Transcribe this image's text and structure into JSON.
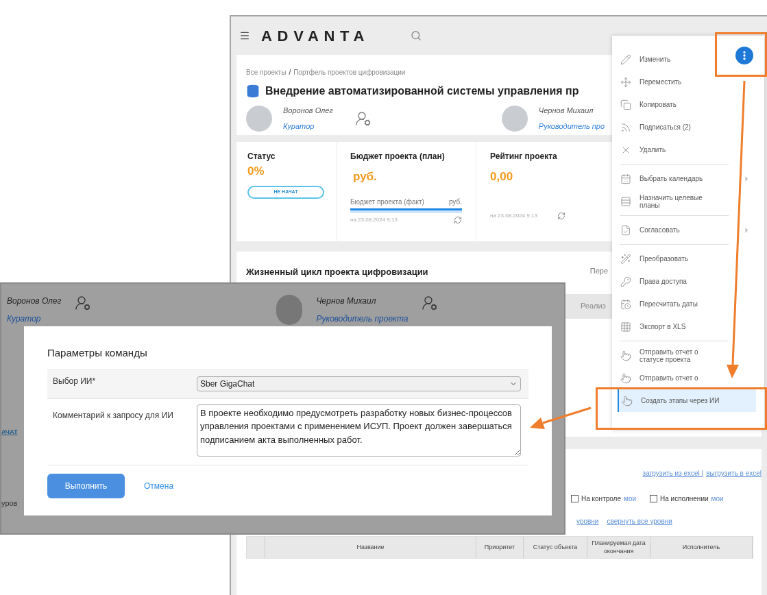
{
  "header": {
    "logo": "ADVANTA"
  },
  "breadcrumbs": {
    "items": [
      "Все проекты",
      "Портфель проектов цифровизации"
    ],
    "separator": "/"
  },
  "project": {
    "title": "Внедрение автоматизированной системы управления пр"
  },
  "people": [
    {
      "name": "Воронов Олег",
      "role": "Куратор"
    },
    {
      "name": "Чернов Михаил",
      "role": "Руководитель про"
    }
  ],
  "metrics": [
    {
      "kind": "status",
      "label": "Статус",
      "value": "0%",
      "badge": "НЕ НАЧАТ"
    },
    {
      "kind": "budget",
      "label": "Бюджет проекта (план)",
      "value": "руб.",
      "sub_label": "Бюджет проекта (факт)",
      "sub_value": "руб.",
      "level": 1,
      "date": "на 23.08.2024 9:13"
    },
    {
      "kind": "rating",
      "label": "Рейтинг проекта",
      "value": "0,00",
      "date": "на 23.08.2024 9:13"
    }
  ],
  "lifecycle": {
    "title": "Жизненный цикл проекта цифровизации",
    "column_2": "Пере",
    "stage": "Реализ"
  },
  "stages": {
    "links": [
      "загрузить из excel |",
      "выгрузить в excel"
    ],
    "filters": [
      {
        "label": "На контроле",
        "link": "мои",
        "checked": false
      },
      {
        "label": "На исполнении",
        "link": "мои",
        "checked": false
      }
    ],
    "level_links": [
      "уровни",
      "свернуть все уровни"
    ],
    "columns": [
      "Название",
      "Приоритет",
      "Статус объекта",
      "Планируемая дата окончания",
      "Исполнитель"
    ]
  },
  "menu": {
    "groups": [
      [
        {
          "label": "Изменить",
          "submenu": false,
          "selected": false
        },
        {
          "label": "Переместить",
          "submenu": false,
          "selected": false
        },
        {
          "label": "Копировать",
          "submenu": false,
          "selected": false
        },
        {
          "label": "Подписаться (2)",
          "submenu": false,
          "selected": false
        },
        {
          "label": "Удалить",
          "submenu": false,
          "selected": false
        }
      ],
      [
        {
          "label": "Выбрать календарь",
          "submenu": true,
          "selected": false
        },
        {
          "label": "Назначить целевые планы",
          "submenu": false,
          "selected": false
        }
      ],
      [
        {
          "label": "Согласовать",
          "submenu": true,
          "selected": false
        }
      ],
      [
        {
          "label": "Преобразовать",
          "submenu": false,
          "selected": false
        },
        {
          "label": "Права доступа",
          "submenu": false,
          "selected": false
        },
        {
          "label": "Пересчитать даты",
          "submenu": false,
          "selected": false
        },
        {
          "label": "Экспорт в XLS",
          "submenu": false,
          "selected": false
        }
      ],
      [
        {
          "label": "Отправить отчет о статусе проекта",
          "submenu": false,
          "selected": false
        },
        {
          "label": "Отправить отчет о",
          "submenu": false,
          "selected": false
        },
        {
          "label": "Создать этапы через ИИ",
          "submenu": false,
          "selected": true
        }
      ]
    ]
  },
  "dialog": {
    "backdrop_people": [
      {
        "name": "Воронов Олег",
        "role": "Куратор"
      },
      {
        "name": "Чернов Михаил",
        "role": "Руководитель проекта"
      }
    ],
    "backdrop_fragments": [
      "АЧАТ",
      "уров"
    ],
    "title": "Параметры команды",
    "fields": [
      {
        "kind": "select",
        "label": "Выбор ИИ*",
        "value": "Sber GigaChat"
      },
      {
        "kind": "textarea",
        "label": "Комментарий к запросу для ИИ",
        "value": "В проекте необходимо предусмотреть разработку новых бизнес-процессов управления проектами с применением ИСУП. Проект должен завершаться подписанием акта выполненных работ."
      }
    ],
    "buttons": [
      {
        "kind": "primary",
        "label": "Выполнить"
      },
      {
        "kind": "link",
        "label": "Отмена"
      }
    ]
  }
}
